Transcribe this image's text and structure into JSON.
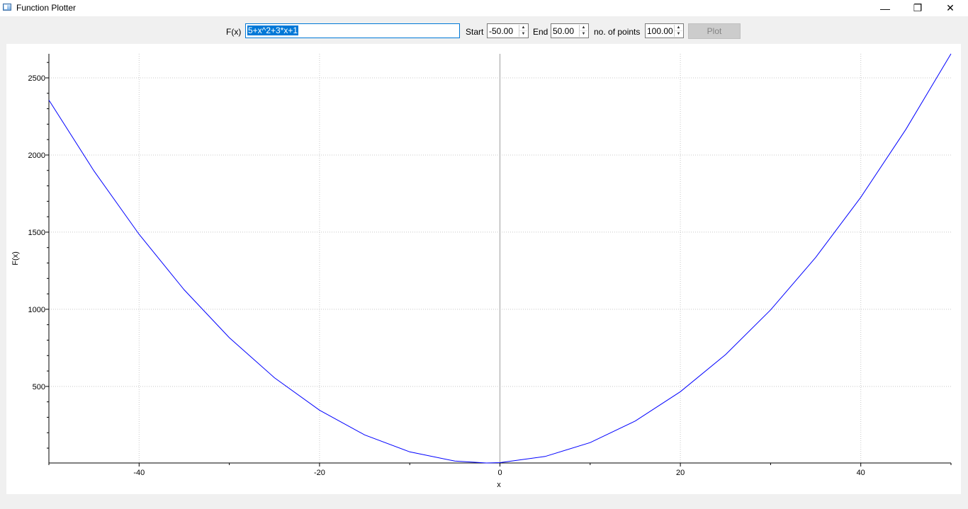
{
  "window": {
    "title": "Function Plotter",
    "minimize_glyph": "—",
    "maximize_glyph": "❐",
    "close_glyph": "✕"
  },
  "toolbar": {
    "fx_label": "F(x)",
    "fx_value": "5+x^2+3*x+1",
    "start_label": "Start",
    "start_value": "-50.00",
    "end_label": "End",
    "end_value": "50.00",
    "points_label": "no. of points",
    "points_value": "100.00",
    "plot_label": "Plot",
    "plot_enabled": false
  },
  "colors": {
    "curve": "#0000ff",
    "selection": "#0078d7",
    "grid": "#c8c8c8"
  },
  "chart_data": {
    "type": "line",
    "title": "",
    "xlabel": "x",
    "ylabel": "F(x)",
    "xlim": [
      -50,
      50
    ],
    "ylim": [
      3.75,
      2656
    ],
    "x_ticks": [
      -40,
      -20,
      0,
      20,
      40
    ],
    "x_tick_labels": [
      "-40",
      "-20",
      "0",
      "20",
      "40"
    ],
    "y_ticks": [
      500,
      1000,
      1500,
      2000,
      2500
    ],
    "y_tick_labels": [
      "500",
      "1000",
      "1500",
      "2000",
      "2500"
    ],
    "grid": true,
    "series": [
      {
        "x": [
          -50,
          -45,
          -40,
          -35,
          -30,
          -25,
          -20,
          -15,
          -10,
          -5,
          -1.5,
          0,
          5,
          10,
          15,
          20,
          25,
          30,
          35,
          40,
          45,
          50
        ],
        "y": [
          2356,
          1896,
          1486,
          1126,
          816,
          556,
          346,
          186,
          76,
          16,
          3.75,
          6,
          46,
          136,
          276,
          466,
          706,
          996,
          1336,
          1726,
          2166,
          2656
        ]
      }
    ]
  }
}
